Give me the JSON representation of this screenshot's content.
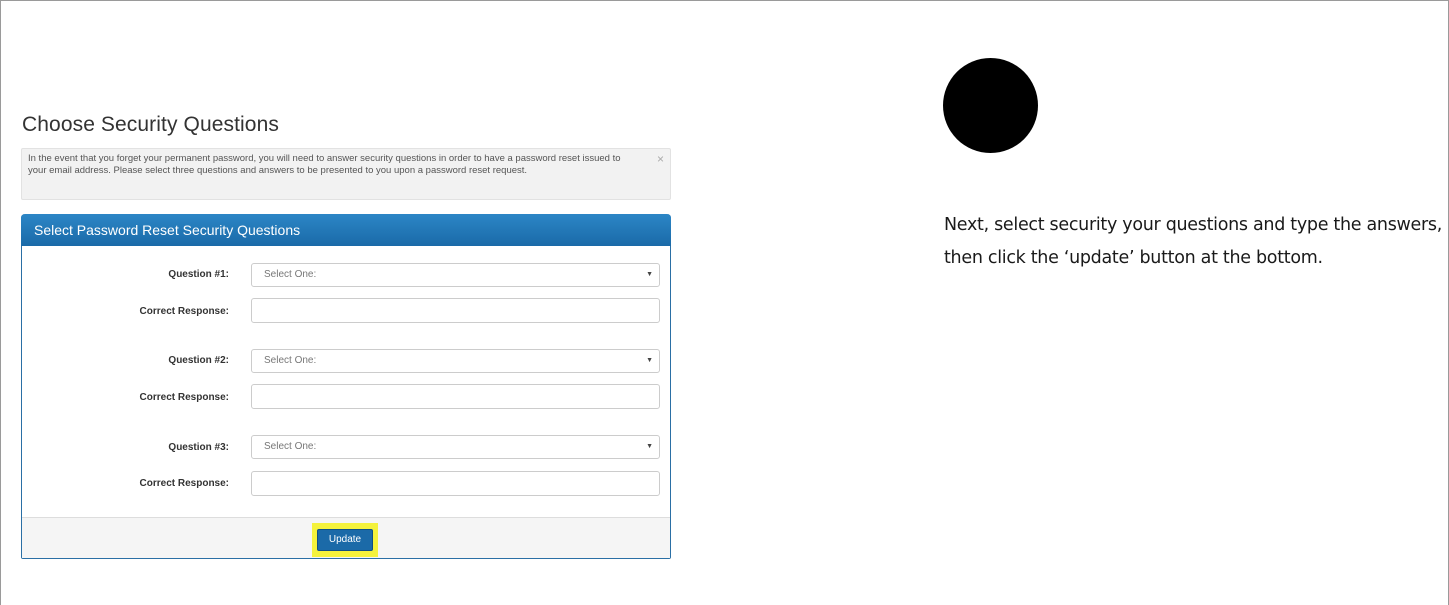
{
  "page": {
    "title": "Choose Security Questions",
    "alert_text": "In the event that you forget your permanent password, you will need to answer security questions in order to have a password reset issued to your email address. Please select three questions and answers to be presented to you upon a password reset request.",
    "alert_close_glyph": "×"
  },
  "panel": {
    "heading": "Select Password Reset Security Questions",
    "questions": [
      {
        "label": "Question #1:",
        "selected": "Select One:",
        "response_label": "Correct Response:",
        "response_value": ""
      },
      {
        "label": "Question #2:",
        "selected": "Select One:",
        "response_label": "Correct Response:",
        "response_value": ""
      },
      {
        "label": "Question #3:",
        "selected": "Select One:",
        "response_label": "Correct Response:",
        "response_value": ""
      }
    ],
    "caret_glyph": "▼",
    "update_label": "Update"
  },
  "instruction": {
    "text": "Next, select security your questions and type the answers, then click the ‘update’ button at the bottom."
  },
  "colors": {
    "panel_header": "#1a6aa8",
    "button": "#1b6aa8",
    "highlight": "#f4f23c",
    "step_dot": "#000000"
  }
}
